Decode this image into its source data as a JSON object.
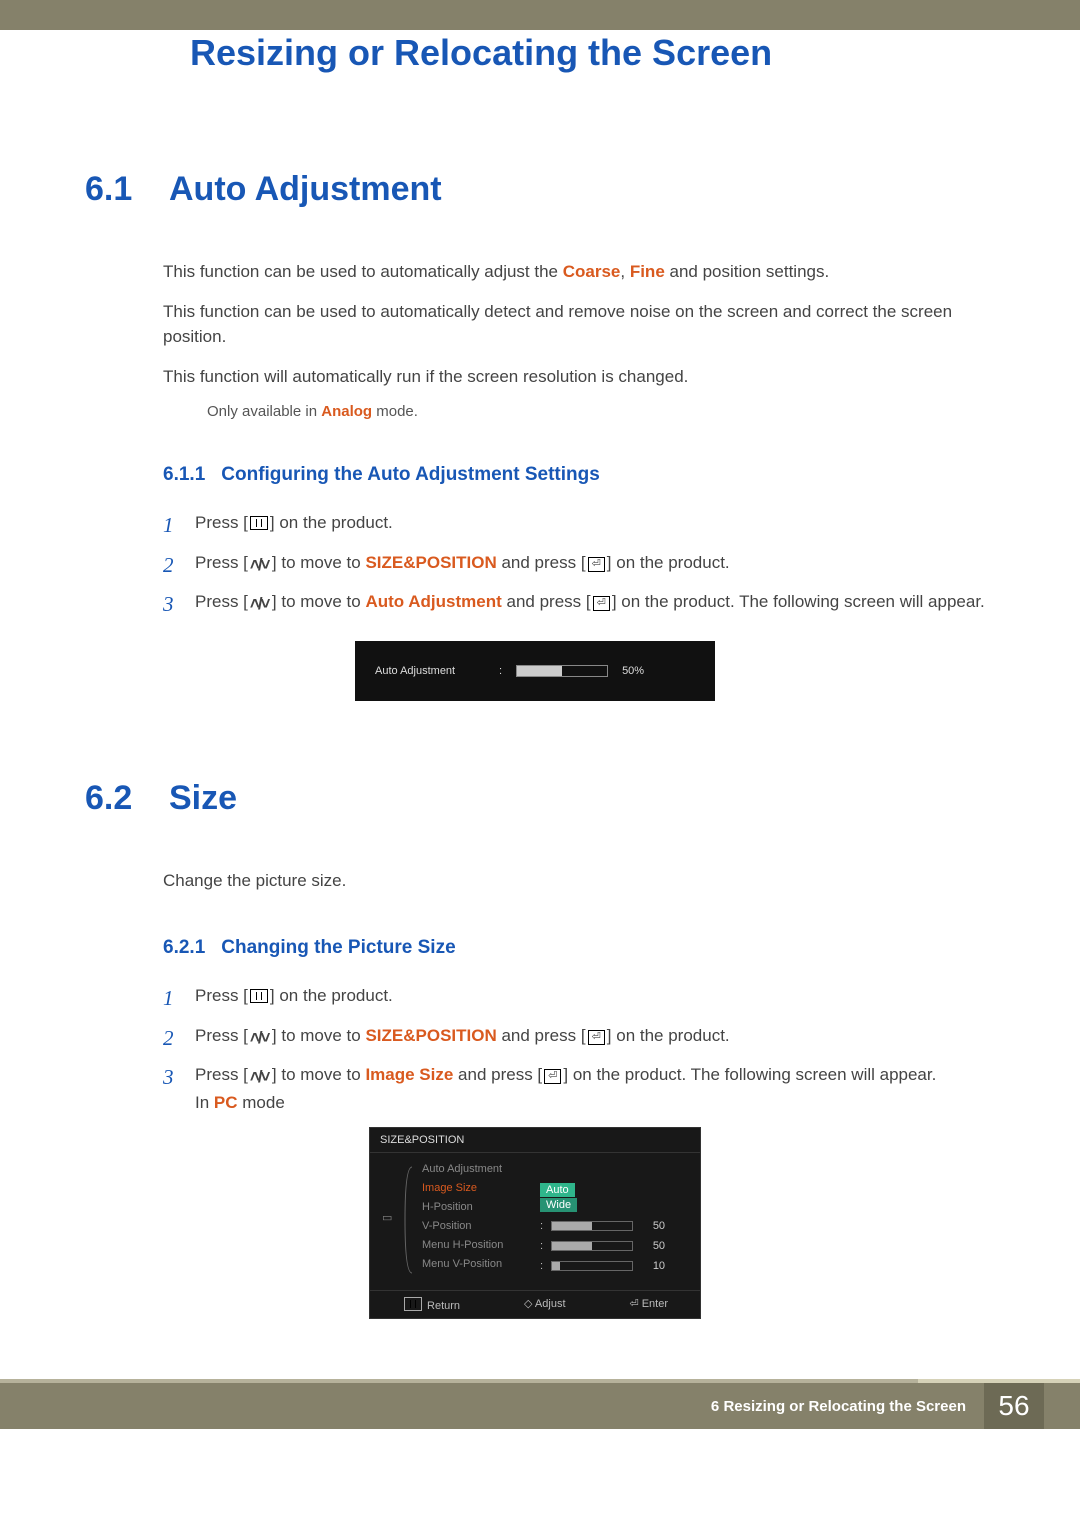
{
  "chapter": {
    "number": "6",
    "title": "Resizing or Relocating the Screen"
  },
  "s61": {
    "num": "6.1",
    "title": "Auto Adjustment",
    "p1a": "This function can be used to automatically adjust the ",
    "p1b": "Coarse",
    "p1c": ", ",
    "p1d": "Fine",
    "p1e": " and position settings.",
    "p2": "This function can be used to automatically detect and remove noise on the screen and correct the screen position.",
    "p3": "This function will automatically run if the screen resolution is changed.",
    "noteA": "Only available in ",
    "noteB": "Analog",
    "noteC": " mode."
  },
  "s611": {
    "num": "6.1.1",
    "title": "Configuring the Auto Adjustment Settings",
    "step1a": "Press [",
    "step1b": "] on the product.",
    "step2a": "Press [",
    "step2b": "] to move to ",
    "step2c": "SIZE&POSITION",
    "step2d": " and press [",
    "step2e": "] on the product.",
    "step3a": "Press [",
    "step3b": "] to move to ",
    "step3c": "Auto Adjustment",
    "step3d": " and press [",
    "step3e": "] on the product. The following screen will appear."
  },
  "osd_progress": {
    "label": "Auto Adjustment",
    "value": "50%"
  },
  "s62": {
    "num": "6.2",
    "title": "Size",
    "p1": "Change the picture size."
  },
  "s621": {
    "num": "6.2.1",
    "title": "Changing the Picture Size",
    "step1a": "Press [",
    "step1b": "] on the product.",
    "step2a": "Press [",
    "step2b": "] to move to ",
    "step2c": "SIZE&POSITION",
    "step2d": " and press [",
    "step2e": "] on the product.",
    "step3a": "Press [",
    "step3b": "] to move to ",
    "step3c": "Image Size",
    "step3d": " and press [",
    "step3e": "] on the product. The following screen will appear.",
    "step3f": "In ",
    "step3g": "PC",
    "step3h": " mode"
  },
  "osd_menu": {
    "title": "SIZE&POSITION",
    "items": [
      "Auto Adjustment",
      "Image Size",
      "H-Position",
      "V-Position",
      "Menu H-Position",
      "Menu V-Position"
    ],
    "options": [
      "Auto",
      "Wide"
    ],
    "rows": [
      {
        "value": 50,
        "width": 50
      },
      {
        "value": 50,
        "width": 50
      },
      {
        "value": 10,
        "width": 10
      }
    ],
    "foot": {
      "return": "Return",
      "adjust": "Adjust",
      "enter": "Enter"
    }
  },
  "footer": {
    "chapnum": "6",
    "chaptitle": "Resizing or Relocating the Screen",
    "page": "56"
  }
}
